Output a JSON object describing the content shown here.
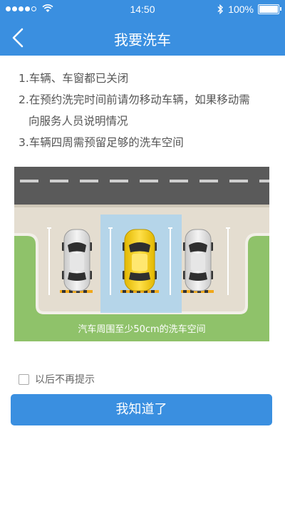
{
  "status_bar": {
    "time": "14:50",
    "battery_text": "100%",
    "signal_bars": 4,
    "icons": [
      "signal-dots-icon",
      "wifi-icon",
      "bluetooth-icon",
      "battery-icon"
    ]
  },
  "header": {
    "title": "我要洗车",
    "back_icon": "chevron-left-icon"
  },
  "notes": {
    "line1": "1.车辆、车窗都已关闭",
    "line2a": "2.在预约洗完时间前请勿移动车辆，如果移动需",
    "line2b": "向服务人员说明情况",
    "line3": "3.车辆四周需预留足够的洗车空间"
  },
  "illustration": {
    "caption": "汽车周围至少50cm的洗车空间"
  },
  "checkbox": {
    "label": "以后不再提示",
    "checked": false
  },
  "confirm_button": {
    "label": "我知道了"
  },
  "colors": {
    "brand_blue": "#3a8fe0",
    "grass": "#8fc26a",
    "road": "#5a5a5a",
    "lot": "#e4ddd0"
  }
}
